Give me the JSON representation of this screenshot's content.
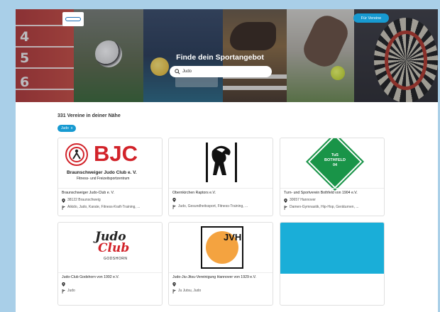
{
  "header": {
    "logo_alt": "sportangebote logo",
    "for_clubs_button": "Für Vereine"
  },
  "hero": {
    "title": "Finde dein Sportangebot",
    "search_value": "Judo",
    "track_numbers": [
      "4",
      "5",
      "6"
    ]
  },
  "results": {
    "count_label": "331 Vereine in deiner Nähe",
    "filter_chip": "Judo",
    "filter_chip_remove": "x"
  },
  "cards": [
    {
      "title": "Braunschweiger Judo-Club e. V.",
      "location": "38122 Braunschweig",
      "sports": "Aikido, Judo, Karate, Fitness-Kraft-Training, ...",
      "logo": {
        "big": "BJC",
        "line1": "Braunschweiger Judo Club e. V.",
        "line2": "Fitness- und Freizeitsportzentrum"
      }
    },
    {
      "title": "Obernkirchen Raptors e.V.",
      "location": "",
      "sports": "Judo, Gesundheitssport, Fitness-Training, ..."
    },
    {
      "title": "Turn- und Sportverein Bothfeld von 1904 e.V.",
      "location": "30657 Hannover",
      "sports": "Damen-Gymnastik, Hip-Hop, Geräturnen, ...",
      "logo": {
        "line1": "TuS",
        "line2": "BOTHFELD",
        "line3": "04"
      }
    },
    {
      "title": "Judo-Club Godshorn von 1992 e.V.",
      "location": "",
      "sports": "Judo",
      "logo": {
        "line1": "Judo",
        "line2": "Club",
        "line3": "GODSHORN"
      }
    },
    {
      "title": "Judo-Jiu-Jitsu-Vereinigung Hannover von 1929 e.V.",
      "location": "",
      "sports": "Ju Jutsu, Judo",
      "logo": {
        "letters": "JVH"
      }
    }
  ],
  "colors": {
    "accent": "#179ad1",
    "bjc_red": "#d2232a",
    "tus_green": "#199448",
    "jvh_orange": "#f4a340",
    "placeholder_card": "#1aaed8"
  }
}
